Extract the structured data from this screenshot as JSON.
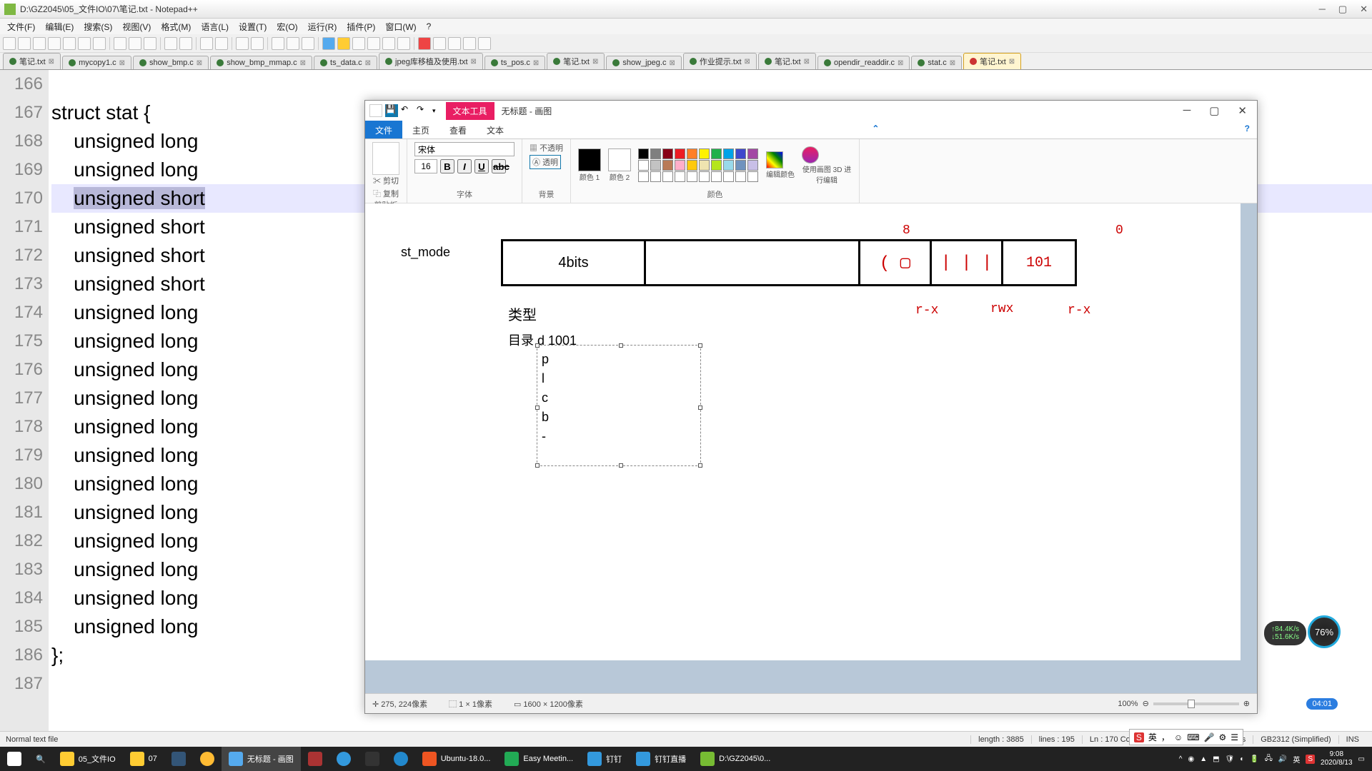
{
  "npp": {
    "title": "D:\\GZ2045\\05_文件IO\\07\\笔记.txt - Notepad++",
    "menus": [
      "文件(F)",
      "编辑(E)",
      "搜索(S)",
      "视图(V)",
      "格式(M)",
      "语言(L)",
      "设置(T)",
      "宏(O)",
      "运行(R)",
      "插件(P)",
      "窗口(W)",
      "?"
    ],
    "tabs": [
      "笔记.txt",
      "mycopy1.c",
      "show_bmp.c",
      "show_bmp_mmap.c",
      "ts_data.c",
      "jpeg库移植及使用.txt",
      "ts_pos.c",
      "笔记.txt",
      "show_jpeg.c",
      "作业提示.txt",
      "笔记.txt",
      "opendir_readdir.c",
      "stat.c",
      "笔记.txt"
    ],
    "activeTab": 13,
    "lines": {
      "start": 166,
      "rows": [
        "",
        "struct stat {",
        "    unsigned long",
        "    unsigned long",
        "    unsigned short",
        "    unsigned short",
        "    unsigned short",
        "    unsigned short",
        "    unsigned long",
        "    unsigned long",
        "    unsigned long",
        "    unsigned long",
        "    unsigned long",
        "    unsigned long",
        "    unsigned long",
        "    unsigned long",
        "    unsigned long",
        "    unsigned long",
        "    unsigned long",
        "    unsigned long",
        "};",
        ""
      ],
      "currentLine": 170
    },
    "status": {
      "lang": "Normal text file",
      "length": "length : 3885",
      "lines": "lines : 195",
      "pos": "Ln : 170   Col : 5   Sel : 14 | 1",
      "eol": "Dos\\Windows",
      "enc": "GB2312 (Simplified)",
      "ins": "INS"
    }
  },
  "paint": {
    "textToolsTab": "文本工具",
    "title": "无标题 - 画图",
    "tabs": {
      "file": "文件",
      "home": "主页",
      "view": "查看",
      "text": "文本"
    },
    "ribbon": {
      "clipboard": "剪贴板",
      "cut": "剪切",
      "copy": "复制",
      "paste": "粘贴",
      "font": "字体",
      "fontName": "宋体",
      "fontSize": "16",
      "bg": "背景",
      "opaque": "不透明",
      "transparent": "透明",
      "color1": "颜色 1",
      "color2": "颜色 2",
      "colors": "颜色",
      "editColors": "编辑颜色",
      "use3d": "使用画图 3D 进行编辑"
    },
    "canvas": {
      "stmode": "st_mode",
      "bits4": "4bits",
      "n8": "8",
      "n0": "0",
      "b101": "101",
      "type": "类型",
      "dir": "目录 d   1001",
      "chars": [
        "p",
        "l",
        "c",
        "b",
        "-"
      ],
      "rx1": "r-x",
      "rwx": "rwx",
      "rx2": "r-x"
    },
    "status": {
      "pos": "275, 224像素",
      "sel": "1 × 1像素",
      "size": "1600 × 1200像素",
      "zoom": "100%"
    }
  },
  "taskbar": {
    "items": [
      "05_文件IO",
      "07",
      "无标题 - 画图",
      "Ubuntu-18.0...",
      "Easy Meetin...",
      "钉钉",
      "钉钉直播",
      "D:\\GZ2045\\0..."
    ],
    "clock": {
      "time": "9:08",
      "date": "2020/8/13"
    }
  },
  "widgets": {
    "up": "↑84.4K/s",
    "down": "↓51.6K/s",
    "pct": "76%",
    "timer": "04:01"
  },
  "ime": {
    "lang": "英",
    "s": "S"
  }
}
